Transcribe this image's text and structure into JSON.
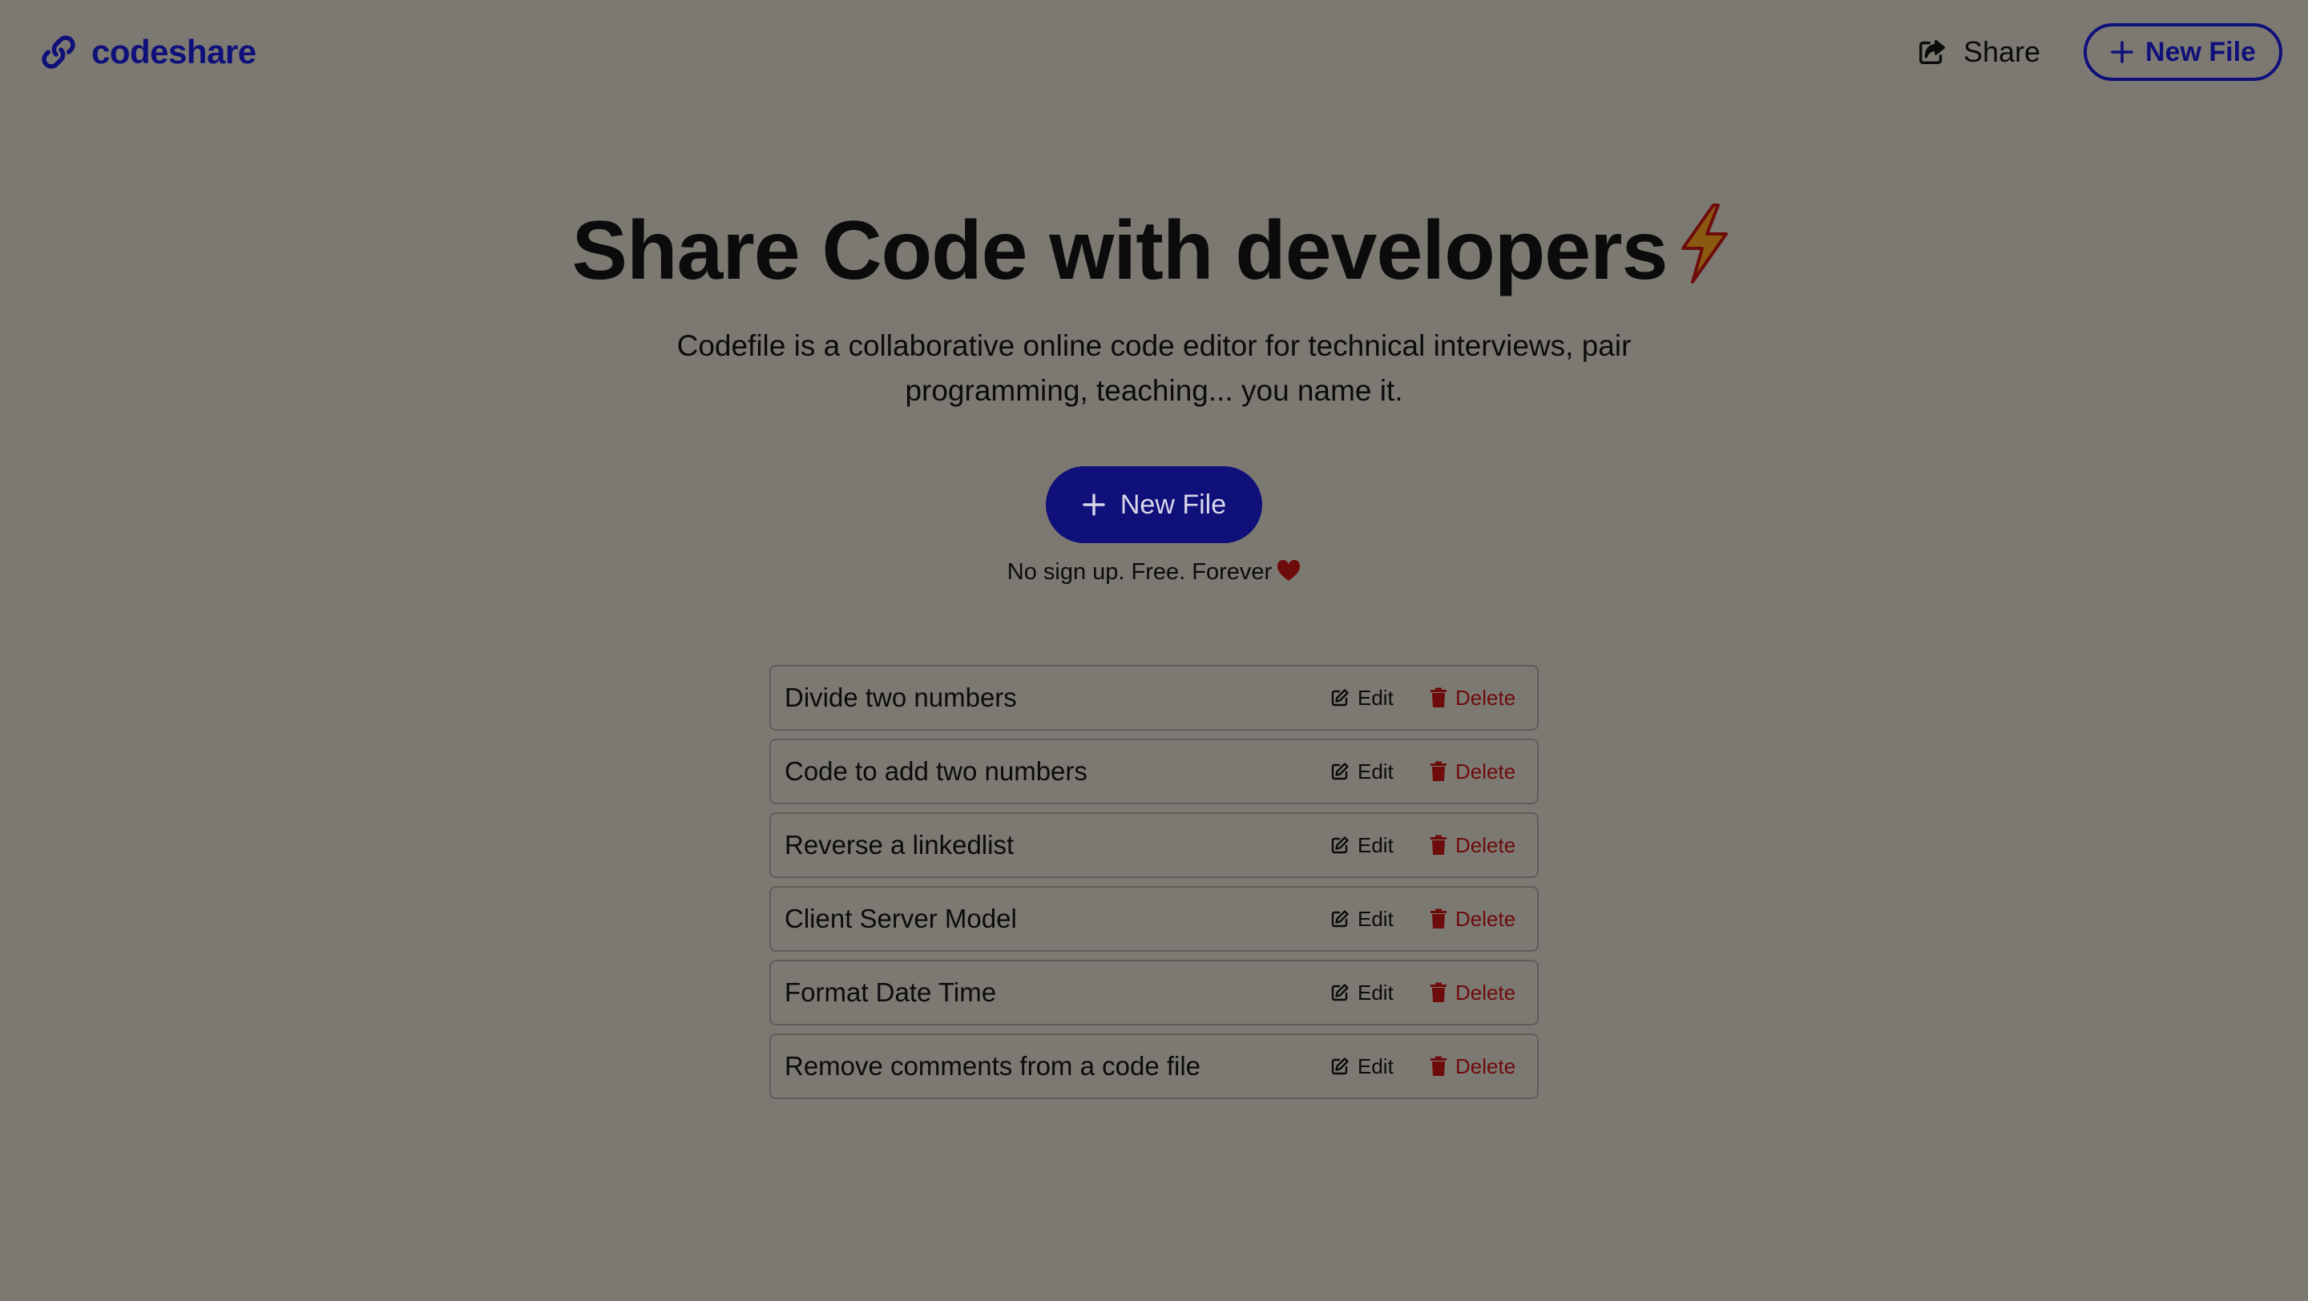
{
  "header": {
    "logo_text": "codeshare",
    "share_label": "Share",
    "new_file_label": "New File"
  },
  "hero": {
    "title": "Share Code with developers",
    "title_emoji": "lightning-bolt-icon",
    "subtitle": "Codefile is a collaborative online code editor for technical interviews, pair programming, teaching... you name it.",
    "cta_label": "New File",
    "tagline": "No sign up. Free. Forever",
    "tagline_emoji": "heart-icon"
  },
  "files": [
    {
      "name": "Divide two numbers",
      "edit_label": "Edit",
      "delete_label": "Delete"
    },
    {
      "name": "Code to add two numbers",
      "edit_label": "Edit",
      "delete_label": "Delete"
    },
    {
      "name": "Reverse a linkedlist",
      "edit_label": "Edit",
      "delete_label": "Delete"
    },
    {
      "name": "Client Server Model",
      "edit_label": "Edit",
      "delete_label": "Delete"
    },
    {
      "name": "Format Date Time",
      "edit_label": "Edit",
      "delete_label": "Delete"
    },
    {
      "name": "Remove comments from a code file",
      "edit_label": "Edit",
      "delete_label": "Delete"
    }
  ],
  "colors": {
    "background": "#7c7973",
    "brand": "#10107a",
    "text": "#0b0b0b",
    "danger": "#6e0b0b",
    "row_border": "#5f5d59"
  }
}
